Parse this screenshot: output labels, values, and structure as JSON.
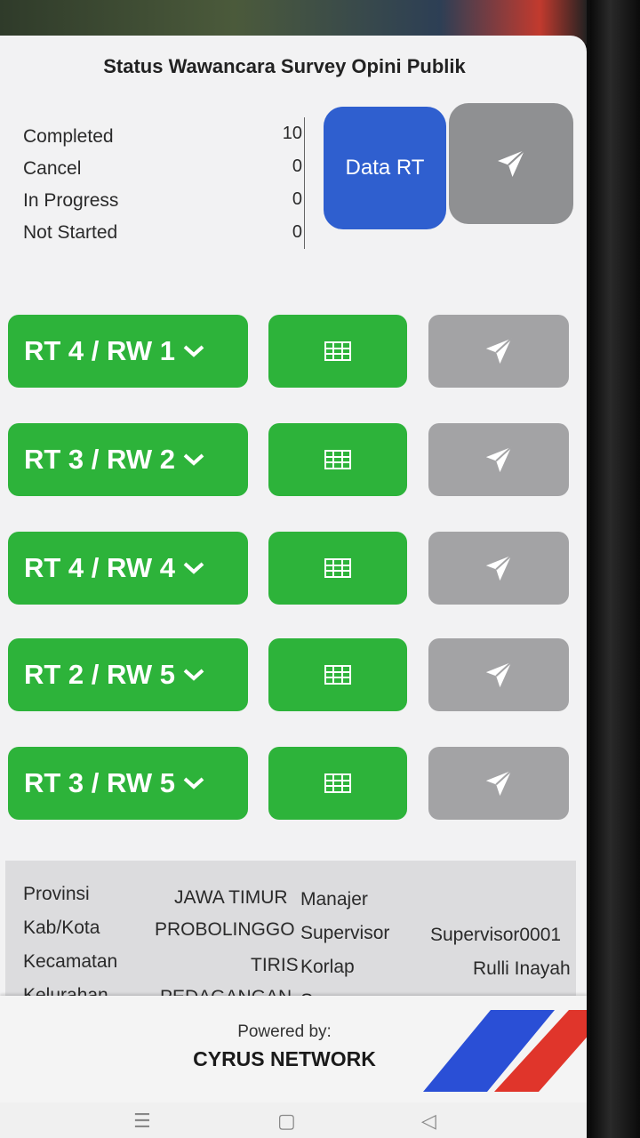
{
  "header": {
    "title": "Status Wawancara Survey Opini Publik"
  },
  "status": {
    "items": [
      {
        "label": "Completed",
        "value": "10"
      },
      {
        "label": "Cancel",
        "value": "0"
      },
      {
        "label": "In Progress",
        "value": "0"
      },
      {
        "label": "Not Started",
        "value": "0"
      }
    ]
  },
  "actions": {
    "data_rt_label": "Data RT",
    "send_icon": "paper-plane-icon"
  },
  "rt_list": [
    {
      "label": "RT 4 / RW 1"
    },
    {
      "label": "RT 3 / RW 2"
    },
    {
      "label": "RT 4 / RW 4"
    },
    {
      "label": "RT 2 / RW 5"
    },
    {
      "label": "RT 3 / RW 5"
    }
  ],
  "info": {
    "provinsi_label": "Provinsi",
    "provinsi_value": "JAWA TIMUR",
    "kab_label": "Kab/Kota",
    "kab_value": "PROBOLINGGO",
    "kec_label": "Kecamatan",
    "kec_value": "TIRIS",
    "kel_label": "Kelurahan",
    "kel_value": "PEDAGANGAN",
    "manajer_label": "Manajer",
    "manajer_value": "",
    "supervisor_label": "Supervisor",
    "supervisor_value": "Supervisor0001",
    "korlap_label": "Korlap",
    "korlap_value": "Rulli Inayah",
    "surveyor_label": "Surveyor",
    "surveyor_value": ""
  },
  "footer": {
    "powered_by": "Powered by:",
    "brand": "CYRUS NETWORK"
  },
  "colors": {
    "green": "#2db33a",
    "blue": "#2f5fcf",
    "gray": "#a3a3a5",
    "brand_blue": "#2a4fd6",
    "brand_red": "#e0352b"
  }
}
